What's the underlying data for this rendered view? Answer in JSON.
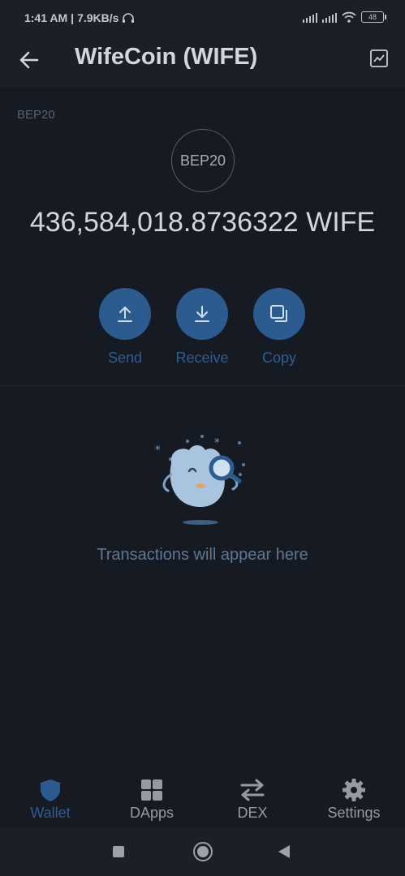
{
  "status_bar": {
    "time": "1:41 AM",
    "separator": "|",
    "speed": "7.9KB/s",
    "battery": "48",
    "icons": [
      "headphones-icon",
      "signal-icon",
      "signal-icon",
      "wifi-icon",
      "battery-icon"
    ]
  },
  "header": {
    "back_icon": "arrow-left-icon",
    "title": "WifeCoin (WIFE)",
    "chart_icon": "chart-line-icon"
  },
  "token": {
    "network_label": "BEP20",
    "icon_text": "BEP20",
    "balance": "436,584,018.8736322 WIFE"
  },
  "actions": [
    {
      "label": "Send",
      "icon": "upload-icon"
    },
    {
      "label": "Receive",
      "icon": "download-icon"
    },
    {
      "label": "Copy",
      "icon": "copy-icon"
    }
  ],
  "empty_state": {
    "message": "Transactions will appear here",
    "illustration": "magnifier-mascot-icon"
  },
  "tabs": [
    {
      "label": "Wallet",
      "icon": "shield-icon",
      "active": true
    },
    {
      "label": "DApps",
      "icon": "grid-icon",
      "active": false
    },
    {
      "label": "DEX",
      "icon": "swap-icon",
      "active": false
    },
    {
      "label": "Settings",
      "icon": "gear-icon",
      "active": false
    }
  ],
  "colors": {
    "background": "#151a23",
    "accent": "#2c5b8f",
    "accent_text": "#2f5d91",
    "muted_text": "#5f7792"
  }
}
